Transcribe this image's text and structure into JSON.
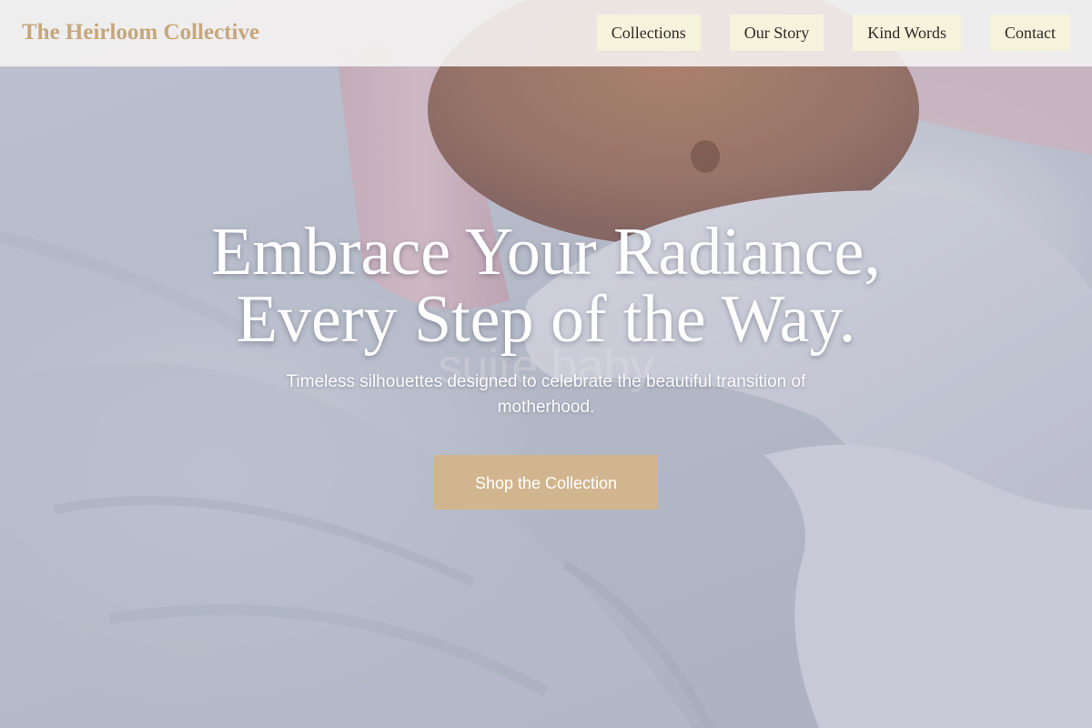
{
  "header": {
    "brand": "The Heirloom Collective",
    "nav": [
      {
        "label": "Collections"
      },
      {
        "label": "Our Story"
      },
      {
        "label": "Kind Words"
      },
      {
        "label": "Contact"
      }
    ]
  },
  "hero": {
    "title_line1": "Embrace Your Radiance,",
    "title_line2": "Every Step of the Way.",
    "subtitle": "Timeless silhouettes designed to celebrate the beautiful transition of motherhood.",
    "cta_label": "Shop the Collection",
    "background_watermark": "suite baby"
  },
  "colors": {
    "brand": "#c6a77c",
    "nav_button_bg": "#f5f3dc",
    "cta_bg": "#d1b58e",
    "hero_text": "#ffffff"
  }
}
